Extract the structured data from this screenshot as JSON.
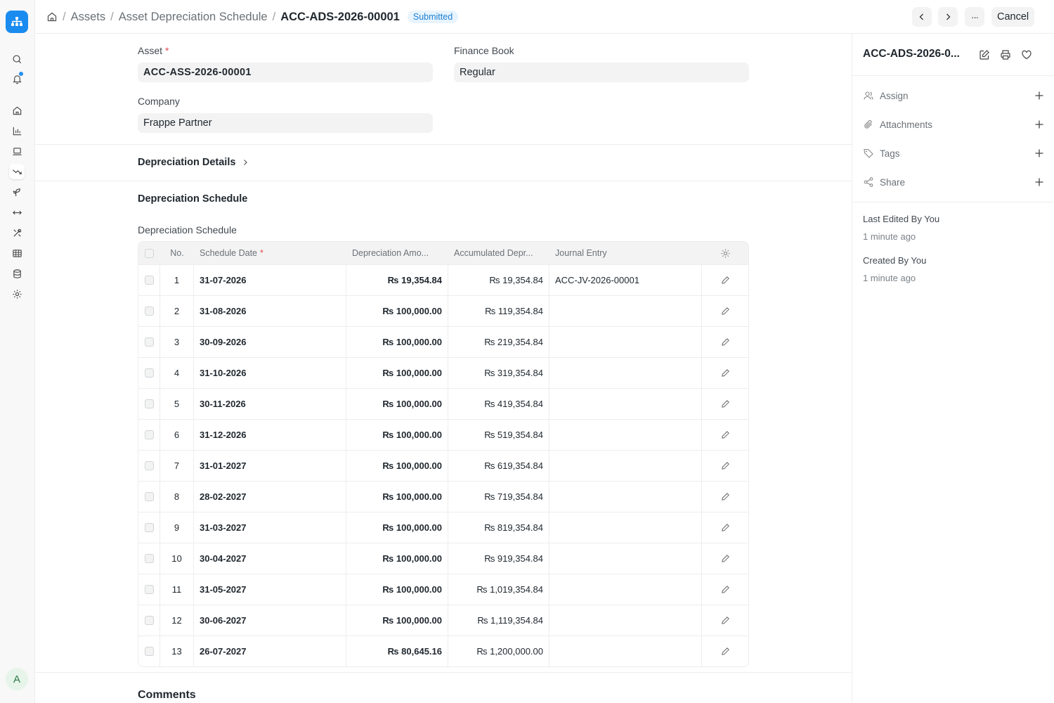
{
  "breadcrumb": {
    "items": [
      "Assets",
      "Asset Depreciation Schedule"
    ],
    "current": "ACC-ADS-2026-00001",
    "status": "Submitted"
  },
  "toolbar": {
    "cancel_label": "Cancel",
    "more_label": "···"
  },
  "form": {
    "asset_label": "Asset",
    "asset_value": "ACC-ASS-2026-00001",
    "finance_book_label": "Finance Book",
    "finance_book_value": "Regular",
    "company_label": "Company",
    "company_value": "Frappe Partner",
    "depreciation_details_label": "Depreciation Details",
    "schedule_section_title": "Depreciation Schedule",
    "schedule_table_label": "Depreciation Schedule",
    "comments_title": "Comments"
  },
  "table": {
    "columns": {
      "no": "No.",
      "schedule_date": "Schedule Date",
      "depreciation_amount": "Depreciation Amo...",
      "accumulated": "Accumulated Depr...",
      "journal_entry": "Journal Entry"
    },
    "rows": [
      {
        "no": "1",
        "date": "31-07-2026",
        "amount": "₨ 19,354.84",
        "accumulated": "₨ 19,354.84",
        "journal": "ACC-JV-2026-00001"
      },
      {
        "no": "2",
        "date": "31-08-2026",
        "amount": "₨ 100,000.00",
        "accumulated": "₨ 119,354.84",
        "journal": ""
      },
      {
        "no": "3",
        "date": "30-09-2026",
        "amount": "₨ 100,000.00",
        "accumulated": "₨ 219,354.84",
        "journal": ""
      },
      {
        "no": "4",
        "date": "31-10-2026",
        "amount": "₨ 100,000.00",
        "accumulated": "₨ 319,354.84",
        "journal": ""
      },
      {
        "no": "5",
        "date": "30-11-2026",
        "amount": "₨ 100,000.00",
        "accumulated": "₨ 419,354.84",
        "journal": ""
      },
      {
        "no": "6",
        "date": "31-12-2026",
        "amount": "₨ 100,000.00",
        "accumulated": "₨ 519,354.84",
        "journal": ""
      },
      {
        "no": "7",
        "date": "31-01-2027",
        "amount": "₨ 100,000.00",
        "accumulated": "₨ 619,354.84",
        "journal": ""
      },
      {
        "no": "8",
        "date": "28-02-2027",
        "amount": "₨ 100,000.00",
        "accumulated": "₨ 719,354.84",
        "journal": ""
      },
      {
        "no": "9",
        "date": "31-03-2027",
        "amount": "₨ 100,000.00",
        "accumulated": "₨ 819,354.84",
        "journal": ""
      },
      {
        "no": "10",
        "date": "30-04-2027",
        "amount": "₨ 100,000.00",
        "accumulated": "₨ 919,354.84",
        "journal": ""
      },
      {
        "no": "11",
        "date": "31-05-2027",
        "amount": "₨ 100,000.00",
        "accumulated": "₨ 1,019,354.84",
        "journal": ""
      },
      {
        "no": "12",
        "date": "30-06-2027",
        "amount": "₨ 100,000.00",
        "accumulated": "₨ 1,119,354.84",
        "journal": ""
      },
      {
        "no": "13",
        "date": "26-07-2027",
        "amount": "₨ 80,645.16",
        "accumulated": "₨ 1,200,000.00",
        "journal": ""
      }
    ]
  },
  "sidebar": {
    "title": "ACC-ADS-2026-0...",
    "actions": [
      {
        "label": "Assign",
        "icon": "user-icon"
      },
      {
        "label": "Attachments",
        "icon": "paperclip-icon"
      },
      {
        "label": "Tags",
        "icon": "tag-icon"
      },
      {
        "label": "Share",
        "icon": "share-icon"
      }
    ],
    "last_edited": "Last Edited By You",
    "last_edited_time": "1 minute ago",
    "created": "Created By You",
    "created_time": "1 minute ago"
  },
  "user": {
    "avatar_initial": "A"
  },
  "colors": {
    "accent": "#2490ef",
    "logo": "#1a8cf0",
    "required": "#e24c4c",
    "badge_bg": "#e8f4fd",
    "badge_text": "#1a7fd4"
  }
}
